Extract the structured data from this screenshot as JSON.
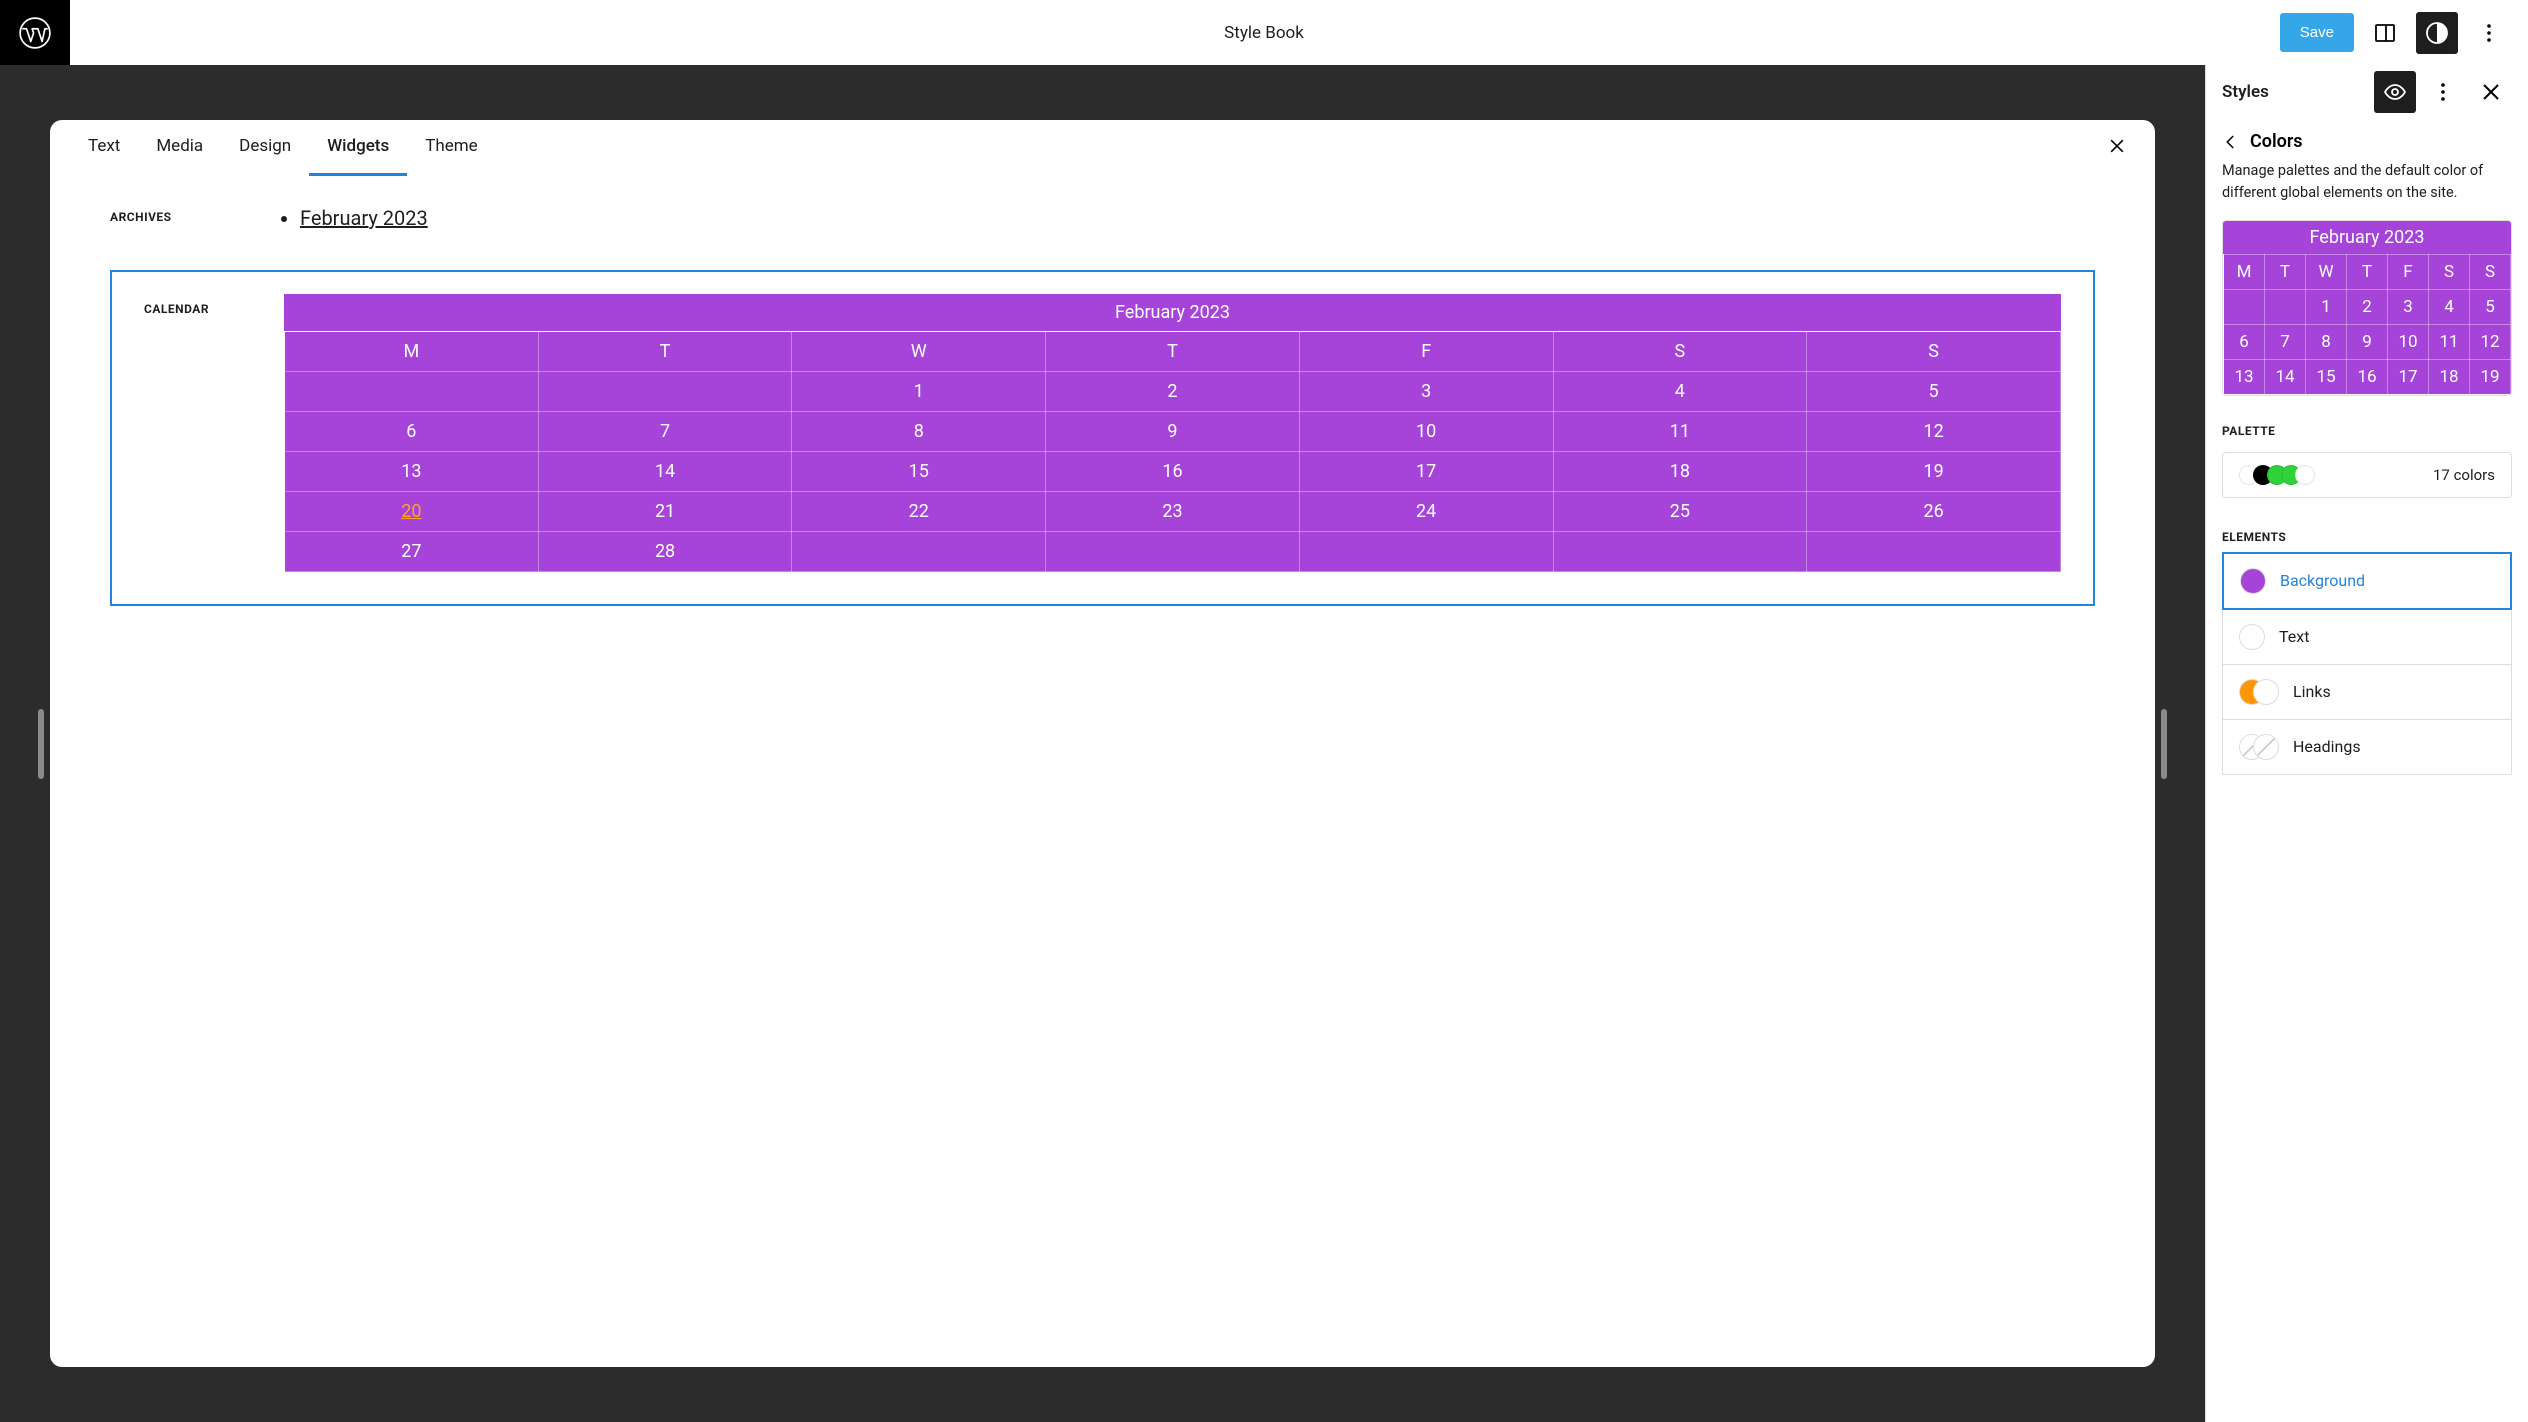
{
  "topbar": {
    "title": "Style Book",
    "save_label": "Save"
  },
  "tabs": [
    "Text",
    "Media",
    "Design",
    "Widgets",
    "Theme"
  ],
  "active_tab": 3,
  "archives": {
    "heading": "ARCHIVES",
    "items": [
      "February 2023"
    ]
  },
  "calendar": {
    "heading": "CALENDAR",
    "caption": "February 2023",
    "weekdays": [
      "M",
      "T",
      "W",
      "T",
      "F",
      "S",
      "S"
    ],
    "weeks": [
      [
        "",
        "",
        "1",
        "2",
        "3",
        "4",
        "5"
      ],
      [
        "6",
        "7",
        "8",
        "9",
        "10",
        "11",
        "12"
      ],
      [
        "13",
        "14",
        "15",
        "16",
        "17",
        "18",
        "19"
      ],
      [
        "20",
        "21",
        "22",
        "23",
        "24",
        "25",
        "26"
      ],
      [
        "27",
        "28",
        "",
        "",
        "",
        "",
        ""
      ]
    ],
    "today": "20"
  },
  "sidebar": {
    "title": "Styles",
    "breadcrumb": "Colors",
    "description": "Manage palettes and the default color of different global elements on the site.",
    "preview_calendar": {
      "caption": "February 2023",
      "weekdays": [
        "M",
        "T",
        "W",
        "T",
        "F",
        "S",
        "S"
      ],
      "weeks": [
        [
          "",
          "",
          "1",
          "2",
          "3",
          "4",
          "5"
        ],
        [
          "6",
          "7",
          "8",
          "9",
          "10",
          "11",
          "12"
        ],
        [
          "13",
          "14",
          "15",
          "16",
          "17",
          "18",
          "19"
        ]
      ]
    },
    "palette_heading": "PALETTE",
    "palette_count": "17 colors",
    "palette_colors": [
      "#ffffff",
      "#000000",
      "#2fd23b",
      "#2fd23b",
      "#ffffff"
    ],
    "elements_heading": "ELEMENTS",
    "elements": [
      {
        "label": "Background",
        "type": "single",
        "color": "#a644d9",
        "selected": true
      },
      {
        "label": "Text",
        "type": "single",
        "color": "#ffffff",
        "selected": false
      },
      {
        "label": "Links",
        "type": "dual",
        "colors": [
          "#ff9500",
          "#ffffff"
        ],
        "selected": false
      },
      {
        "label": "Headings",
        "type": "dual-diag",
        "colors": [
          "#ffffff",
          "#ffffff"
        ],
        "selected": false
      }
    ]
  }
}
